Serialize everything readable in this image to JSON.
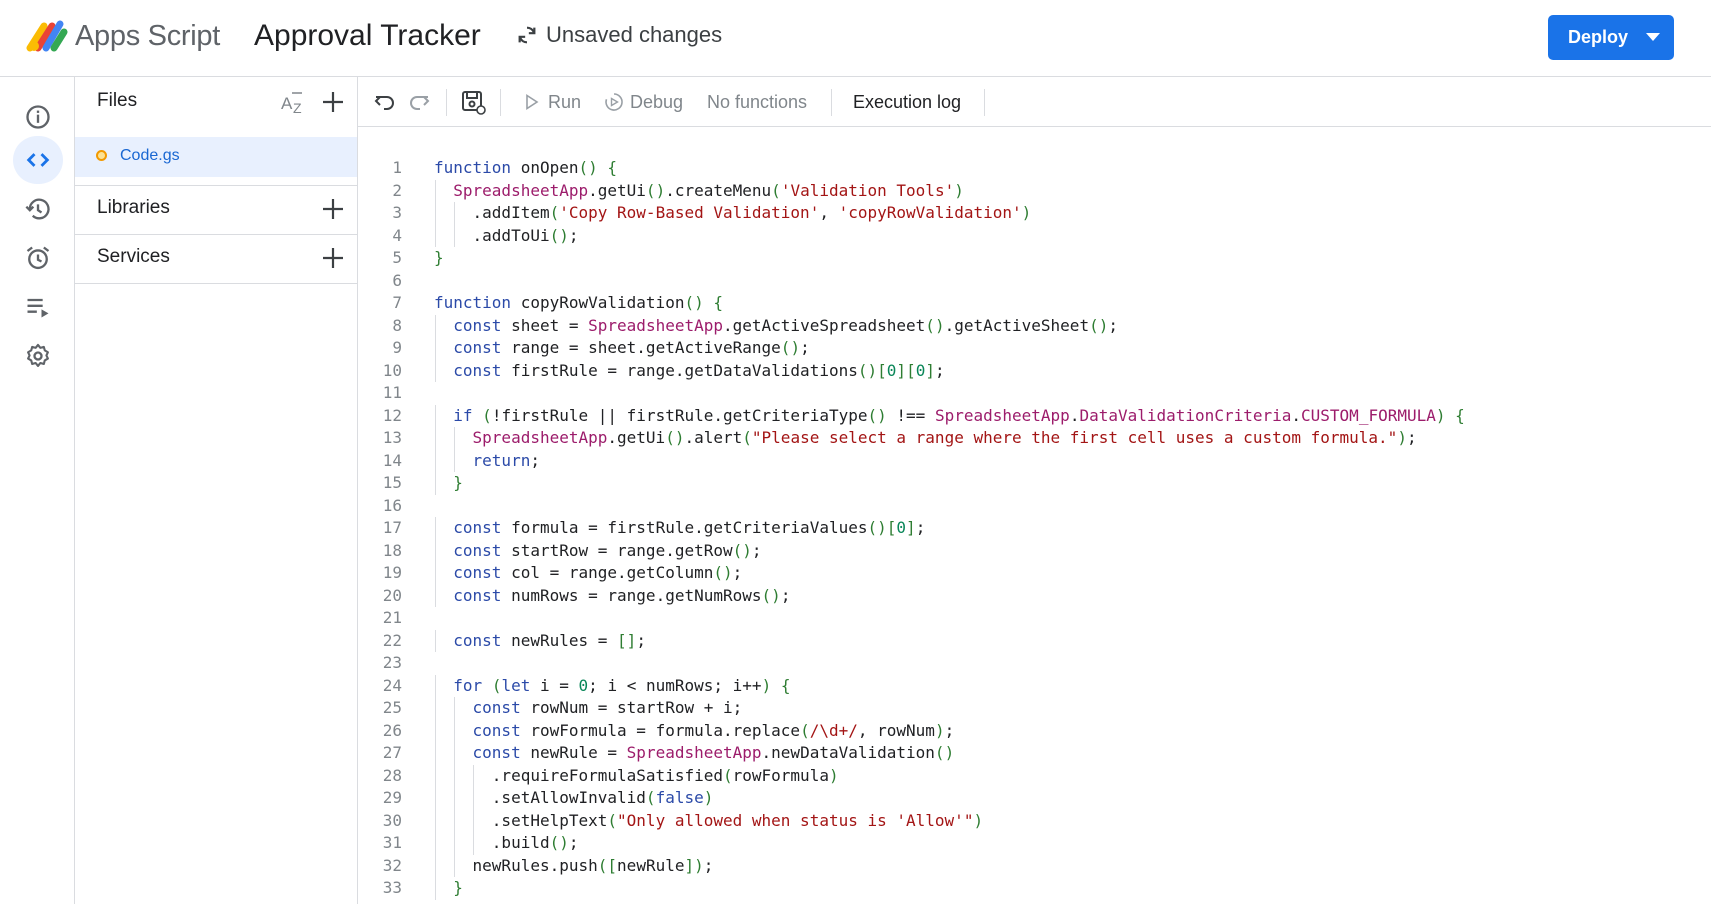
{
  "header": {
    "app_name": "Apps Script",
    "project_title": "Approval Tracker",
    "status": "Unsaved changes",
    "deploy_label": "Deploy"
  },
  "rail": {
    "items": [
      {
        "name": "overview",
        "icon": "info-icon",
        "active": false
      },
      {
        "name": "editor",
        "icon": "code-icon",
        "active": true
      },
      {
        "name": "executions",
        "icon": "history-icon",
        "active": false
      },
      {
        "name": "triggers",
        "icon": "alarm-icon",
        "active": false
      },
      {
        "name": "executions-list",
        "icon": "playlist-icon",
        "active": false
      },
      {
        "name": "settings",
        "icon": "gear-icon",
        "active": false
      }
    ]
  },
  "files_panel": {
    "files_title": "Files",
    "file_name": "Code.gs",
    "libraries_title": "Libraries",
    "services_title": "Services"
  },
  "toolbar": {
    "run_label": "Run",
    "debug_label": "Debug",
    "function_select": "No functions",
    "execution_log_label": "Execution log"
  },
  "colors": {
    "accent": "#1a73e8",
    "keyword": "#2b4aa8",
    "string": "#a31515",
    "class": "#9c1c6b",
    "number": "#098658"
  },
  "code_lines": [
    "function onOpen() {",
    "  SpreadsheetApp.getUi().createMenu('Validation Tools')",
    "    .addItem('Copy Row-Based Validation', 'copyRowValidation')",
    "    .addToUi();",
    "}",
    "",
    "function copyRowValidation() {",
    "  const sheet = SpreadsheetApp.getActiveSpreadsheet().getActiveSheet();",
    "  const range = sheet.getActiveRange();",
    "  const firstRule = range.getDataValidations()[0][0];",
    "",
    "  if (!firstRule || firstRule.getCriteriaType() !== SpreadsheetApp.DataValidationCriteria.CUSTOM_FORMULA) {",
    "    SpreadsheetApp.getUi().alert(\"Please select a range where the first cell uses a custom formula.\");",
    "    return;",
    "  }",
    "",
    "  const formula = firstRule.getCriteriaValues()[0];",
    "  const startRow = range.getRow();",
    "  const col = range.getColumn();",
    "  const numRows = range.getNumRows();",
    "",
    "  const newRules = [];",
    "",
    "  for (let i = 0; i < numRows; i++) {",
    "    const rowNum = startRow + i;",
    "    const rowFormula = formula.replace(/\\d+/, rowNum);",
    "    const newRule = SpreadsheetApp.newDataValidation()",
    "      .requireFormulaSatisfied(rowFormula)",
    "      .setAllowInvalid(false)",
    "      .setHelpText(\"Only allowed when status is 'Allow'\")",
    "      .build();",
    "    newRules.push([newRule]);",
    "  }"
  ]
}
